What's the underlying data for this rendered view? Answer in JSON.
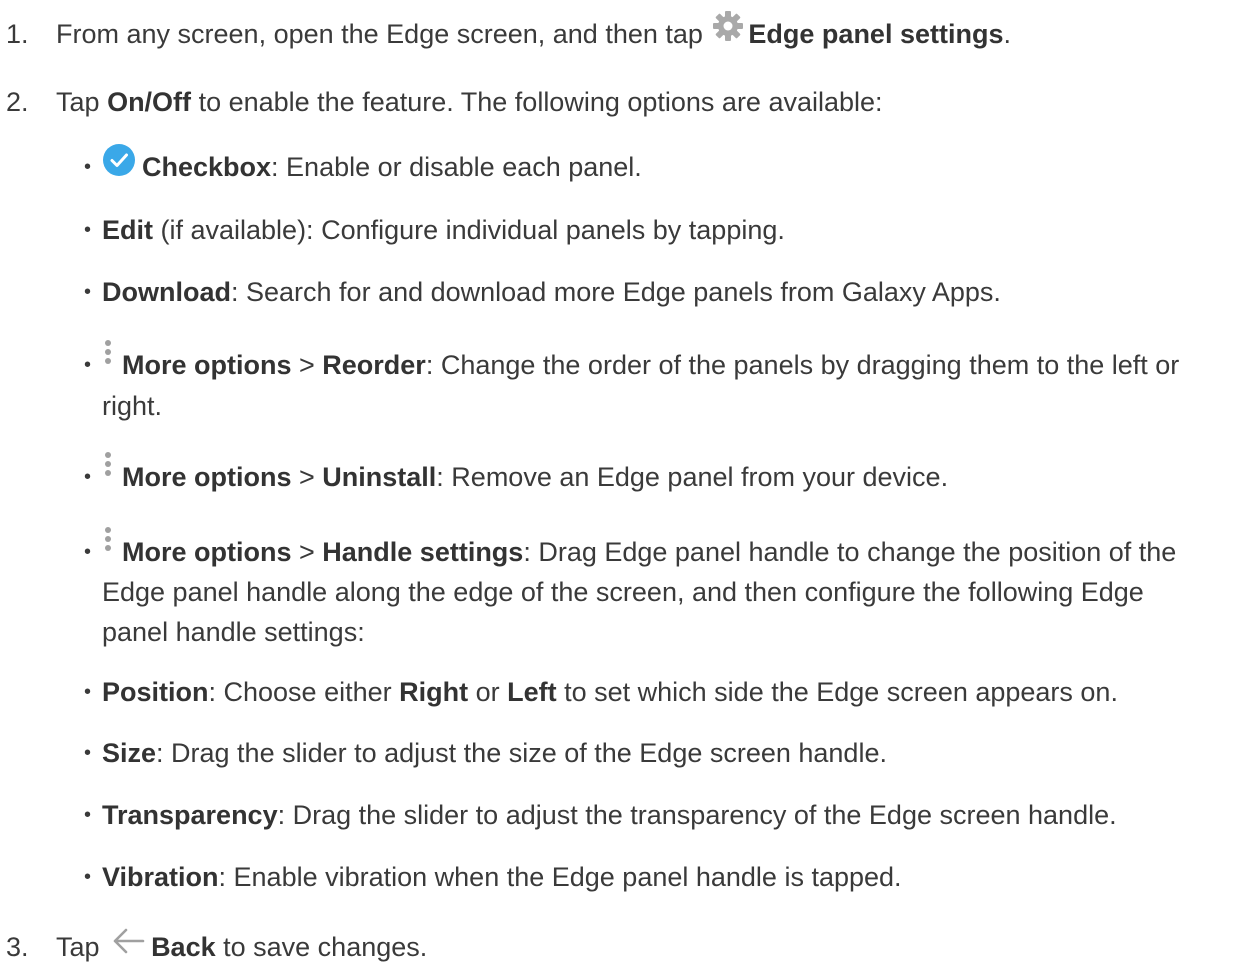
{
  "steps": [
    {
      "number": "1.",
      "pre": "From any screen, open the Edge screen, and then tap",
      "icon": "gear-icon",
      "bold": "Edge panel settings",
      "post": "."
    },
    {
      "number": "2.",
      "pre": "Tap",
      "bold": "On/Off",
      "post": "to enable the feature. The following options are available:"
    },
    {
      "number": "3.",
      "pre": "Tap",
      "icon": "back-arrow-icon",
      "bold": "Back",
      "post": "to save changes."
    }
  ],
  "options": {
    "checkbox": {
      "icon": "checkbox-checked-icon",
      "bold": "Checkbox",
      "text": ": Enable or disable each panel."
    },
    "edit": {
      "bold": "Edit",
      "text": " (if available): Configure individual panels by tapping."
    },
    "download": {
      "bold": "Download",
      "text": ": Search for and download more Edge panels from Galaxy Apps."
    },
    "reorder": {
      "icon": "more-options-icon",
      "bold1": "More options",
      "sep": " > ",
      "bold2": "Reorder",
      "text_line1": ": Change the order of the panels by dragging them to the left or",
      "text_line2": "right."
    },
    "uninstall": {
      "icon": "more-options-icon",
      "bold1": "More options",
      "sep": " > ",
      "bold2": "Uninstall",
      "text": ": Remove an Edge panel from your device."
    },
    "handle_settings": {
      "icon": "more-options-icon",
      "bold1": "More options",
      "sep": " > ",
      "bold2": "Handle settings",
      "text_line1": ": Drag Edge panel handle to change the position of the",
      "text_line2": "Edge panel handle along the edge of the screen, and then configure the following Edge",
      "text_line3": "panel handle settings:"
    },
    "position": {
      "bold": "Position",
      "text1": ": Choose either ",
      "bold_right": "Right",
      "text2": " or ",
      "bold_left": "Left",
      "text3": " to set which side the Edge screen appears on."
    },
    "size": {
      "bold": "Size",
      "text": ": Drag the slider to adjust the size of the Edge screen handle."
    },
    "transparency": {
      "bold": "Transparency",
      "text": ": Drag the slider to adjust the transparency of the Edge screen handle."
    },
    "vibration": {
      "bold": "Vibration",
      "text": ": Enable vibration when the Edge panel handle is tapped."
    }
  },
  "colors": {
    "text": "#3a3a3a",
    "check_blue": "#3aa8e8",
    "icon_gray": "#a0a0a0"
  }
}
